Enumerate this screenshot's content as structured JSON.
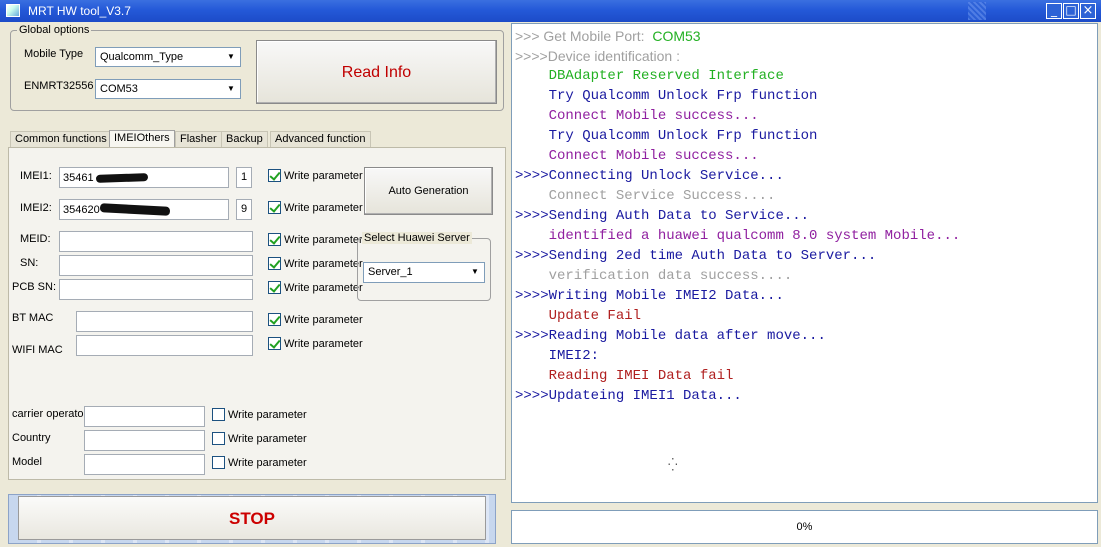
{
  "window": {
    "title": "MRT HW tool_V3.7",
    "min": "_",
    "max": "□",
    "close": "×"
  },
  "global_options": {
    "legend": "Global options",
    "mobile_type_label": "Mobile Type",
    "mobile_type_value": "Qualcomm_Type",
    "device_label": "ENMRT32556",
    "port_value": "COM53",
    "read_info_button": "Read Info"
  },
  "tabs": [
    {
      "label": "Common functions",
      "active": false
    },
    {
      "label": "IMEIOthers",
      "active": true
    },
    {
      "label": "Flasher",
      "active": false
    },
    {
      "label": "Backup",
      "active": false
    },
    {
      "label": "Advanced function",
      "active": false
    }
  ],
  "imei_panel": {
    "imei1_label": "IMEI1:",
    "imei1_value": "35461",
    "imei1_check": "1",
    "imei2_label": "IMEI2:",
    "imei2_value": "354620",
    "imei2_check": "9",
    "meid_label": "MEID:",
    "sn_label": "SN:",
    "pcb_sn_label": "PCB SN:",
    "bt_mac_label": "BT MAC",
    "wifi_mac_label": "WIFI MAC",
    "carrier_label": "carrier operator",
    "country_label": "Country",
    "model_label": "Model",
    "write_parameter": "Write parameter",
    "auto_generation_button": "Auto Generation",
    "server_group_legend": "Select Huawei Server",
    "server_value": "Server_1"
  },
  "stop_button": "STOP",
  "log_lines": [
    {
      "segments": [
        {
          "text": ">>> Get Mobile Port:  ",
          "color": "#A0A0A0"
        },
        {
          "text": "COM53",
          "color": "#22B022"
        }
      ],
      "sans": true
    },
    {
      "segments": [
        {
          "text": ">>>>Device identification :",
          "color": "#A0A0A0"
        }
      ],
      "sans": true
    },
    {
      "segments": [
        {
          "text": "    DBAdapter Reserved Interface",
          "color": "#22B022"
        }
      ]
    },
    {
      "segments": [
        {
          "text": "    Try Qualcomm Unlock Frp function",
          "color": "#1A1AA0"
        }
      ]
    },
    {
      "segments": [
        {
          "text": "    Connect Mobile success...",
          "color": "#9020A0"
        }
      ]
    },
    {
      "segments": [
        {
          "text": "    Try Qualcomm Unlock Frp function",
          "color": "#1A1AA0"
        }
      ]
    },
    {
      "segments": [
        {
          "text": "    Connect Mobile success...",
          "color": "#9020A0"
        }
      ]
    },
    {
      "segments": [
        {
          "text": ">>>>Connecting Unlock Service...",
          "color": "#1A1AA0"
        }
      ]
    },
    {
      "segments": [
        {
          "text": "    Connect Service Success....",
          "color": "#A0A0A0"
        }
      ]
    },
    {
      "segments": [
        {
          "text": ">>>>Sending Auth Data to Service...",
          "color": "#1A1AA0"
        }
      ]
    },
    {
      "segments": [
        {
          "text": "    identified a huawei qualcomm 8.0 system Mobile...",
          "color": "#9020A0"
        }
      ]
    },
    {
      "segments": [
        {
          "text": ">>>>Sending 2ed time Auth Data to Server...",
          "color": "#1A1AA0"
        }
      ]
    },
    {
      "segments": [
        {
          "text": "    verification data success....",
          "color": "#A0A0A0"
        }
      ]
    },
    {
      "segments": [
        {
          "text": ">>>>Writing Mobile IMEI2 Data...",
          "color": "#1A1AA0"
        }
      ]
    },
    {
      "segments": [
        {
          "text": "    Update Fail",
          "color": "#B02020"
        }
      ]
    },
    {
      "segments": [
        {
          "text": ">>>>Reading Mobile data after move...",
          "color": "#1A1AA0"
        }
      ]
    },
    {
      "segments": [
        {
          "text": "    IMEI2:",
          "color": "#1A1AA0"
        }
      ]
    },
    {
      "segments": [
        {
          "text": "    Reading IMEI Data fail",
          "color": "#B02020"
        }
      ]
    },
    {
      "segments": [
        {
          "text": ">>>>Updateing IMEI1 Data...",
          "color": "#1A1AA0"
        }
      ]
    }
  ],
  "progress": {
    "label": "0%",
    "value": 0
  }
}
